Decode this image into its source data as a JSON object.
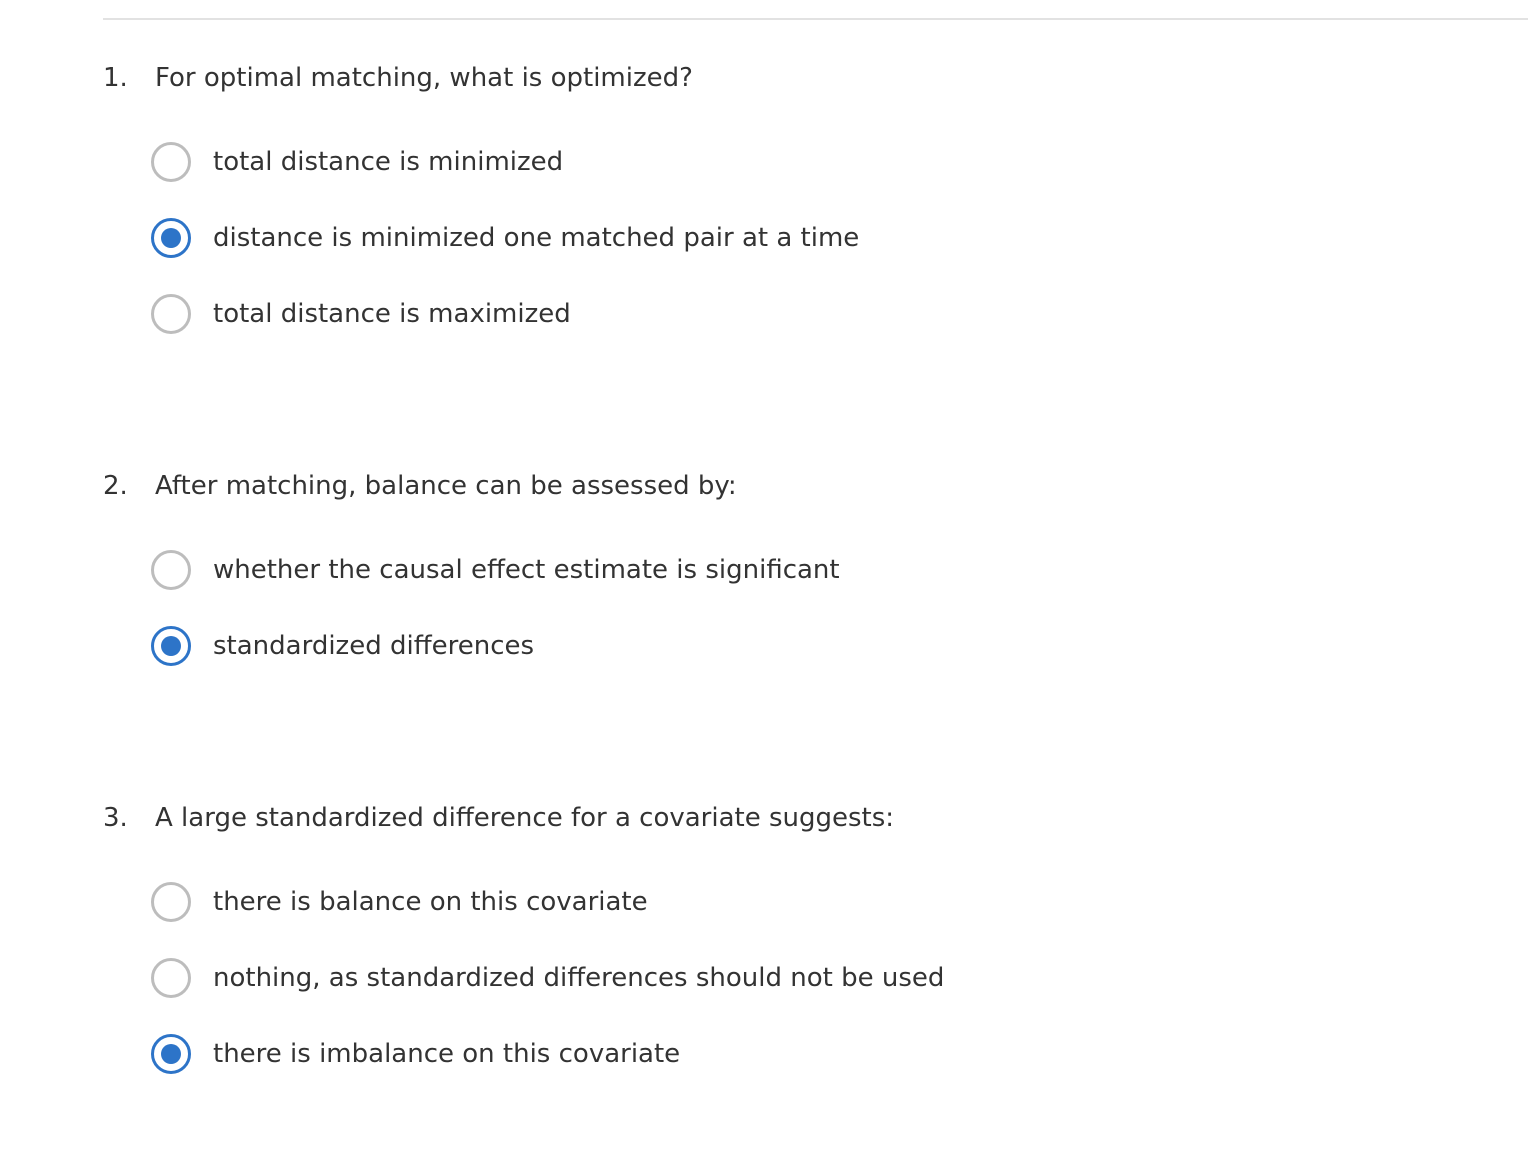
{
  "questions": [
    {
      "number": "1.",
      "text": "For optimal matching, what is optimized?",
      "options": [
        {
          "label": "total distance is minimized",
          "selected": false
        },
        {
          "label": "distance is minimized one matched pair at a time",
          "selected": true
        },
        {
          "label": "total distance is maximized",
          "selected": false
        }
      ]
    },
    {
      "number": "2.",
      "text": "After matching, balance can be assessed by:",
      "options": [
        {
          "label": "whether the causal effect estimate is significant",
          "selected": false
        },
        {
          "label": "standardized differences",
          "selected": true
        }
      ]
    },
    {
      "number": "3.",
      "text": "A large standardized difference for a covariate suggests:",
      "options": [
        {
          "label": "there is balance on this covariate",
          "selected": false
        },
        {
          "label": "nothing, as standardized differences should not be used",
          "selected": false
        },
        {
          "label": "there is imbalance on this covariate",
          "selected": true
        }
      ]
    }
  ],
  "colors": {
    "accent": "#2d74c8",
    "radio_border": "#bdbdbd",
    "text": "#333333",
    "divider": "#e2e2e2"
  }
}
